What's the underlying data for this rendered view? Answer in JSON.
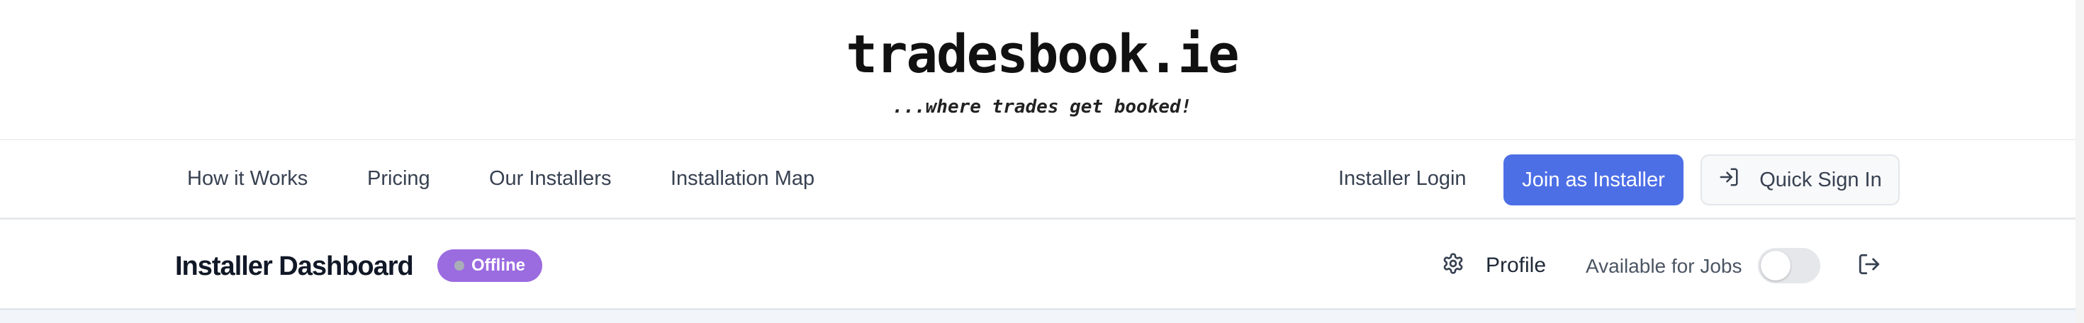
{
  "brand": {
    "name": "tradesbook.ie",
    "tagline": "...where trades get booked!"
  },
  "nav": {
    "links": [
      "How it Works",
      "Pricing",
      "Our Installers",
      "Installation Map"
    ],
    "installer_login": "Installer Login",
    "join_button": "Join as Installer",
    "quick_sign_in": "Quick Sign In"
  },
  "dashboard": {
    "title": "Installer Dashboard",
    "status_badge": "Offline",
    "profile_label": "Profile",
    "availability_label": "Available for Jobs",
    "availability_on": false
  },
  "colors": {
    "primary": "#4d6fe6",
    "badge": "#9b6be0",
    "toggle_off": "#e5e7eb"
  },
  "icons": [
    "sign-in-icon",
    "gear-icon",
    "logout-icon"
  ]
}
